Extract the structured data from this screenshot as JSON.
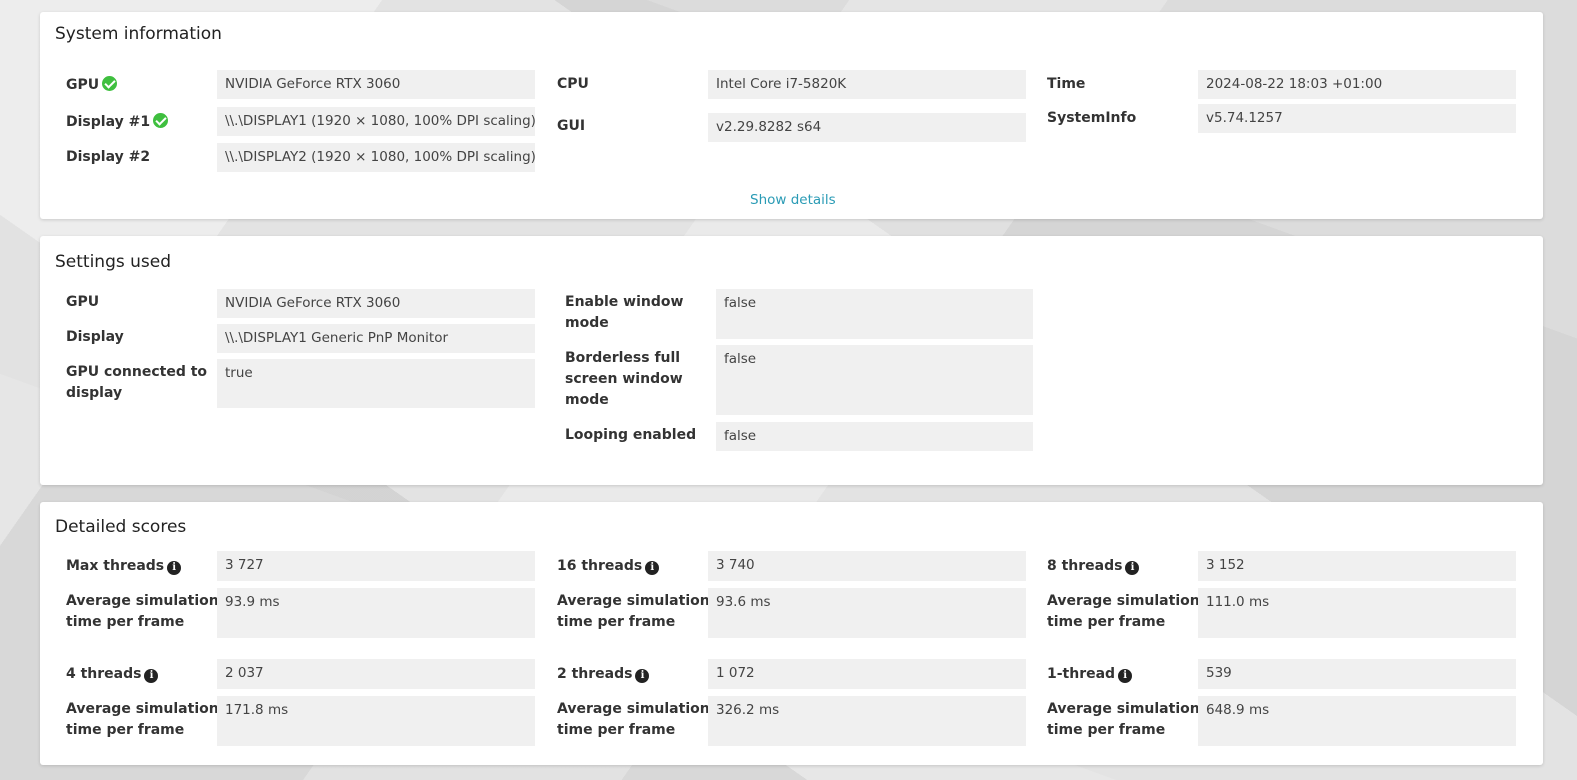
{
  "system_information": {
    "title": "System information",
    "gpu_label": "GPU",
    "gpu_value": "NVIDIA GeForce RTX 3060",
    "display1_label": "Display #1",
    "display1_value": "\\\\.\\DISPLAY1 (1920 × 1080, 100% DPI scaling)",
    "display2_label": "Display #2",
    "display2_value": "\\\\.\\DISPLAY2 (1920 × 1080, 100% DPI scaling)",
    "cpu_label": "CPU",
    "cpu_value": "Intel Core i7-5820K",
    "gui_label": "GUI",
    "gui_value": "v2.29.8282 s64",
    "time_label": "Time",
    "time_value": "2024-08-22 18:03 +01:00",
    "systeminfo_label": "SystemInfo",
    "systeminfo_value": "v5.74.1257",
    "show_details": "Show details"
  },
  "settings_used": {
    "title": "Settings used",
    "gpu_label": "GPU",
    "gpu_value": "NVIDIA GeForce RTX 3060",
    "display_label": "Display",
    "display_value": "\\\\.\\DISPLAY1 Generic PnP Monitor",
    "gpu_connected_label_1": "GPU connected to",
    "gpu_connected_label_2": "display",
    "gpu_connected_value": "true",
    "window_mode_label_1": "Enable window",
    "window_mode_label_2": "mode",
    "window_mode_value": "false",
    "borderless_label_1": "Borderless full",
    "borderless_label_2": "screen window",
    "borderless_label_3": "mode",
    "borderless_value": "false",
    "looping_label": "Looping enabled",
    "looping_value": "false"
  },
  "detailed_scores": {
    "title": "Detailed scores",
    "avg_label_1": "Average simulation",
    "avg_label_2": "time per frame",
    "groups": [
      {
        "label": "Max threads",
        "score": "3 727",
        "avg": "93.9 ms"
      },
      {
        "label": "16 threads",
        "score": "3 740",
        "avg": "93.6 ms"
      },
      {
        "label": "8 threads",
        "score": "3 152",
        "avg": "111.0 ms"
      },
      {
        "label": "4 threads",
        "score": "2 037",
        "avg": "171.8 ms"
      },
      {
        "label": "2 threads",
        "score": "1 072",
        "avg": "326.2 ms"
      },
      {
        "label": "1-thread",
        "score": "539",
        "avg": "648.9 ms"
      }
    ]
  },
  "icons": {
    "check": "check-circle-icon",
    "info": "info-circle-icon"
  },
  "colors": {
    "check_green": "#3fbf3f",
    "link_teal": "#2a9bb5"
  }
}
